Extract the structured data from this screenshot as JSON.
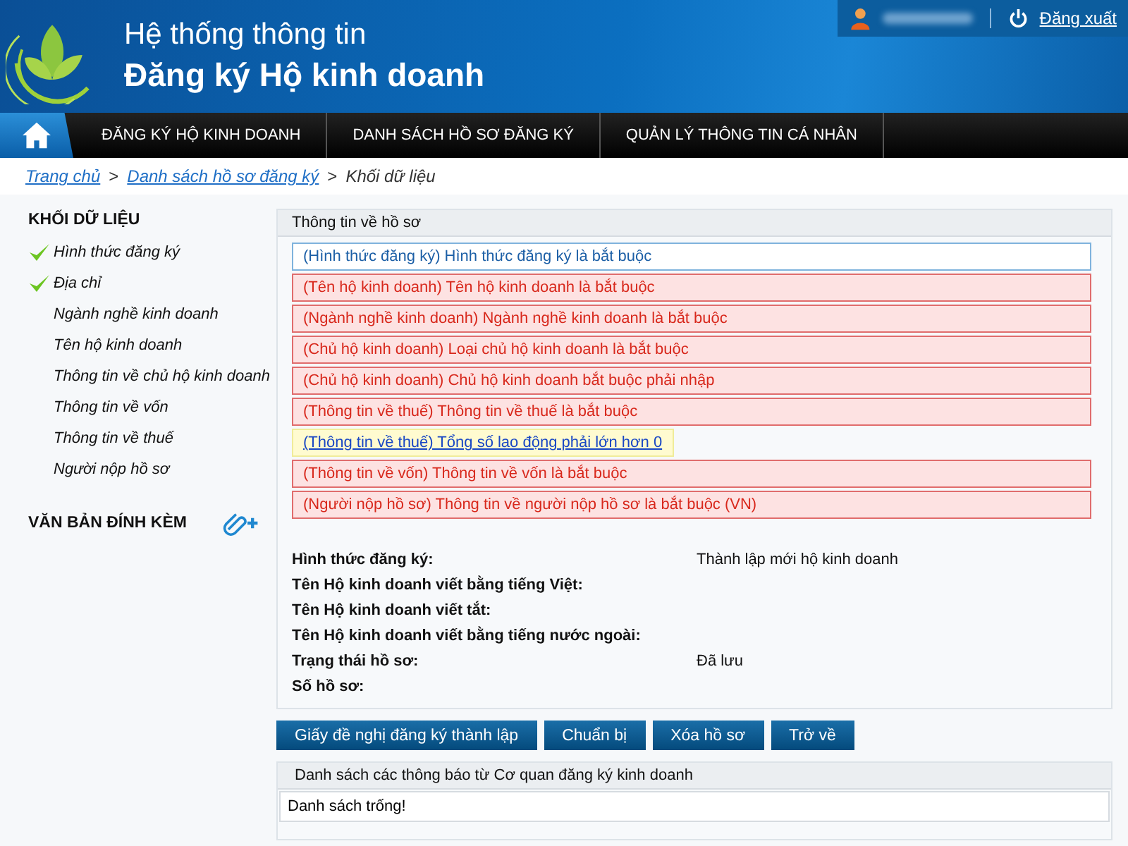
{
  "header": {
    "title_line1": "Hệ thống thông tin",
    "title_line2": "Đăng ký Hộ kinh doanh",
    "logout": "Đăng xuất"
  },
  "nav": {
    "items": [
      {
        "label": "ĐĂNG KÝ HỘ KINH DOANH",
        "selected": false
      },
      {
        "label": "DANH SÁCH HỒ SƠ ĐĂNG KÝ",
        "selected": false
      },
      {
        "label": "QUẢN LÝ THÔNG TIN CÁ NHÂN",
        "selected": false
      }
    ]
  },
  "breadcrumb": [
    {
      "label": "Trang chủ",
      "kind": "link"
    },
    {
      "label": ">",
      "kind": "separator"
    },
    {
      "label": "Danh sách hồ sơ đăng ký",
      "kind": "link"
    },
    {
      "label": ">",
      "kind": "separator"
    },
    {
      "label": "Khối dữ liệu",
      "kind": "current"
    }
  ],
  "sidebar": {
    "heading": "KHỐI DỮ LIỆU",
    "items": [
      {
        "label": "Hình thức đăng ký",
        "checked": true
      },
      {
        "label": "Địa chỉ",
        "checked": true
      },
      {
        "label": "Ngành nghề kinh doanh",
        "checked": false
      },
      {
        "label": "Tên hộ kinh doanh",
        "checked": false
      },
      {
        "label": "Thông tin về chủ hộ kinh doanh",
        "checked": false
      },
      {
        "label": "Thông tin về vốn",
        "checked": false
      },
      {
        "label": "Thông tin về thuế",
        "checked": false
      },
      {
        "label": "Người nộp hồ sơ",
        "checked": false
      }
    ],
    "attachments_heading": "VĂN BẢN ĐÍNH KÈM"
  },
  "profile_panel": {
    "title": "Thông tin về hồ sơ",
    "messages": [
      {
        "kind": "info",
        "text": "(Hình thức đăng ký) Hình thức đăng ký là bắt buộc"
      },
      {
        "kind": "error",
        "text": "(Tên hộ kinh doanh) Tên hộ kinh doanh là bắt buộc"
      },
      {
        "kind": "error",
        "text": "(Ngành nghề kinh doanh) Ngành nghề kinh doanh là bắt buộc"
      },
      {
        "kind": "error",
        "text": "(Chủ hộ kinh doanh) Loại chủ hộ kinh doanh là bắt buộc"
      },
      {
        "kind": "error",
        "text": "(Chủ hộ kinh doanh) Chủ hộ kinh doanh bắt buộc phải nhập"
      },
      {
        "kind": "error",
        "text": "(Thông tin về thuế) Thông tin về thuế là bắt buộc"
      },
      {
        "kind": "warning",
        "text": "(Thông tin về thuế) Tổng số lao động phải lớn hơn 0"
      },
      {
        "kind": "error",
        "text": "(Thông tin về vốn) Thông tin về vốn là bắt buộc"
      },
      {
        "kind": "error",
        "text": "(Người nộp hồ sơ) Thông tin về người nộp hồ sơ là bắt buộc (VN)"
      }
    ],
    "fields": [
      {
        "label": "Hình thức đăng ký:",
        "value": "Thành lập mới hộ kinh doanh"
      },
      {
        "label": "Tên Hộ kinh doanh viết bằng tiếng Việt:"
      },
      {
        "label": "Tên Hộ kinh doanh viết tắt:"
      },
      {
        "label": "Tên Hộ kinh doanh viết bằng tiếng nước ngoài:"
      },
      {
        "label": "Trạng thái hồ sơ:",
        "value": "Đã lưu"
      },
      {
        "label": "Số hồ sơ:"
      }
    ]
  },
  "buttons": [
    "Giấy đề nghị đăng ký thành lập",
    "Chuẩn bị",
    "Xóa hồ sơ",
    "Trở về"
  ],
  "notices_panel": {
    "title": "Danh sách các thông báo từ Cơ quan đăng ký kinh doanh",
    "empty_text": "Danh sách trống!"
  }
}
